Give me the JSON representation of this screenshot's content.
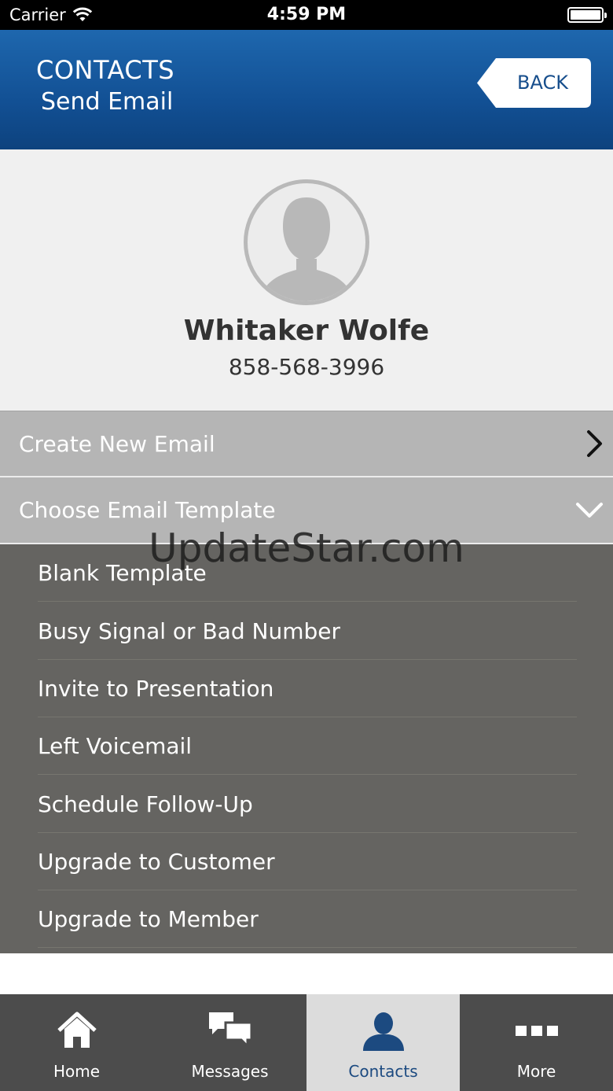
{
  "status_bar": {
    "carrier": "Carrier",
    "time": "4:59 PM"
  },
  "header": {
    "title": "CONTACTS",
    "subtitle": "Send Email",
    "back_label": "BACK"
  },
  "contact": {
    "name": "Whitaker Wolfe",
    "phone": "858-568-3996"
  },
  "menu": {
    "create_new_email": "Create New Email",
    "choose_email_template": "Choose Email Template"
  },
  "templates": [
    "Blank Template",
    "Busy Signal or Bad Number",
    "Invite to Presentation",
    "Left Voicemail",
    "Schedule Follow-Up",
    "Upgrade to Customer",
    "Upgrade to Member"
  ],
  "watermark": "UpdateStar.com",
  "tabs": [
    {
      "label": "Home",
      "icon": "home-icon"
    },
    {
      "label": "Messages",
      "icon": "messages-icon"
    },
    {
      "label": "Contacts",
      "icon": "contacts-icon",
      "active": true
    },
    {
      "label": "More",
      "icon": "more-icon"
    }
  ],
  "colors": {
    "header_blue": "#125094",
    "active_tab_text": "#1c4a80",
    "menu_gray": "#b5b5b5",
    "list_gray": "#656461"
  }
}
